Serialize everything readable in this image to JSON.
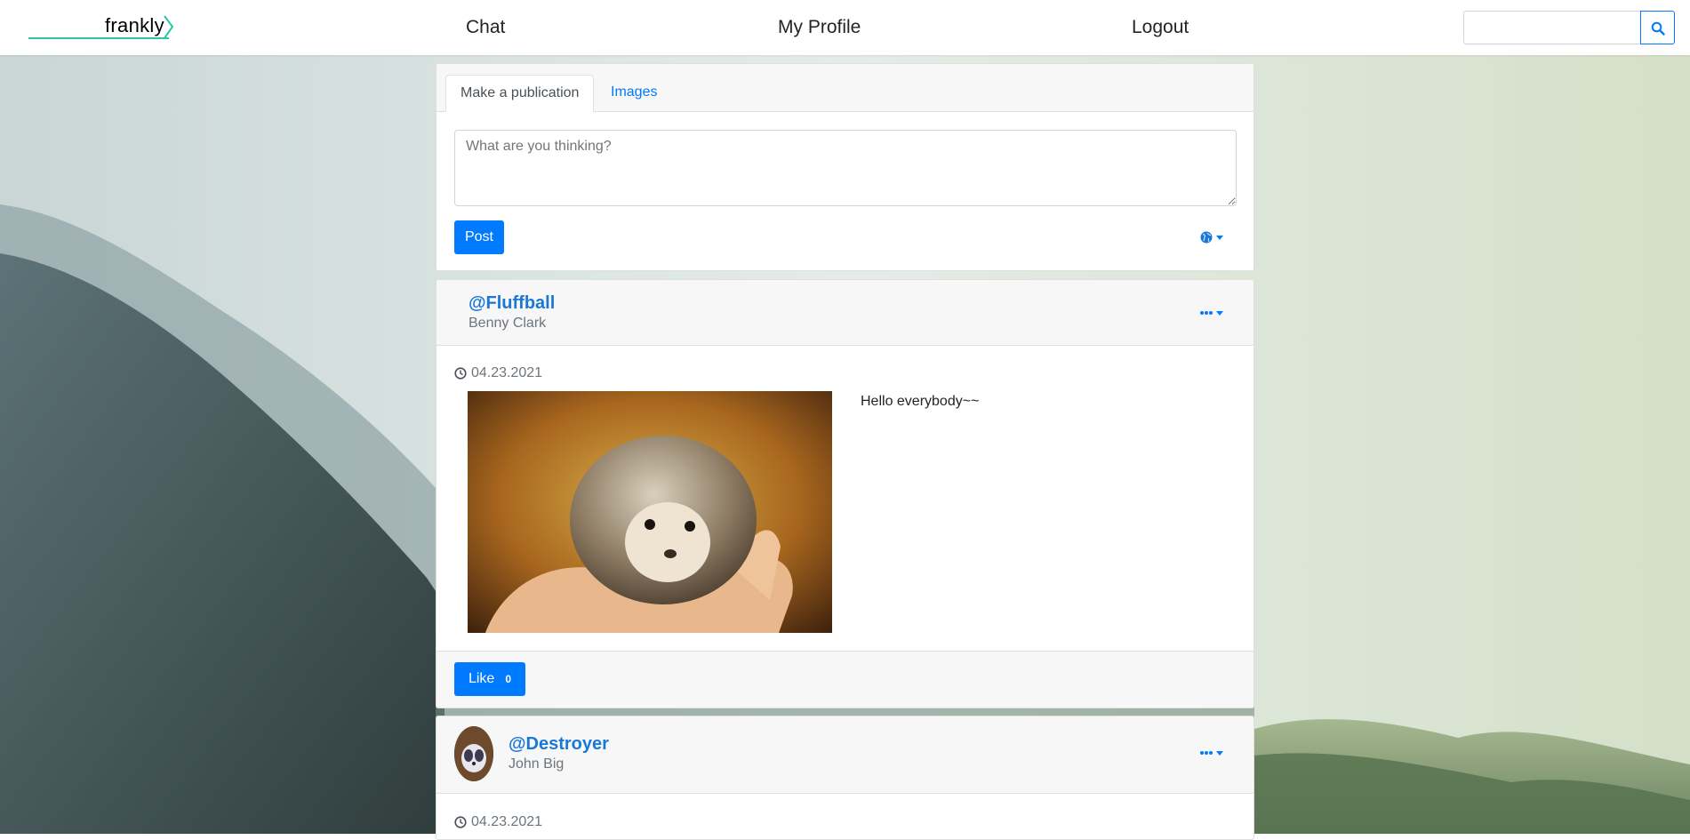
{
  "nav": {
    "brand": "frankly",
    "links": [
      "Chat",
      "My Profile",
      "Logout"
    ],
    "search_value": "",
    "search_icon": "search-icon",
    "accent": "#007bff"
  },
  "composer": {
    "tabs": [
      "Make a publication",
      "Images"
    ],
    "placeholder": "What are you thinking?",
    "post_label": "Post",
    "visibility_icon": "globe-icon"
  },
  "posts": [
    {
      "username": "@Fluffball",
      "fullname": "Benny Clark",
      "date": "04.23.2021",
      "text": "Hello everybody~~",
      "image": "hedgehog-photo",
      "like_label": "Like",
      "like_count": "0",
      "menu_icon": "ellipsis-icon"
    },
    {
      "username": "@Destroyer",
      "fullname": "John Big",
      "date": "04.23.2021",
      "avatar": "avatar-image",
      "menu_icon": "ellipsis-icon"
    }
  ]
}
